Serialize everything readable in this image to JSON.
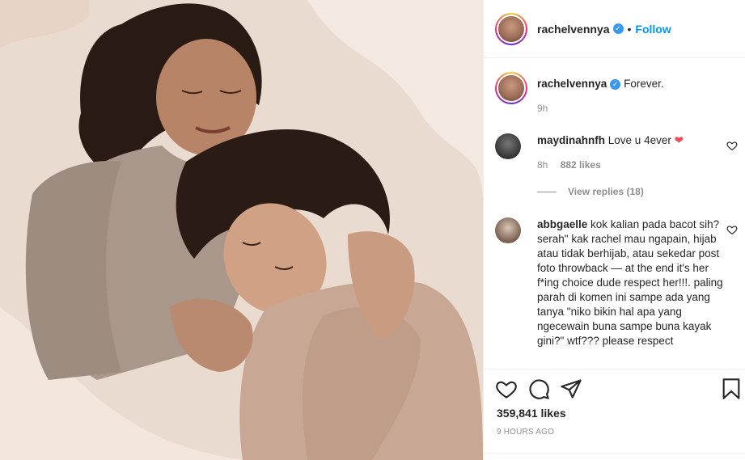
{
  "post": {
    "username": "rachelvennya",
    "follow_label": "Follow",
    "dot": "•",
    "verified_mark": "✓"
  },
  "caption": {
    "username": "rachelvennya",
    "text": "Forever.",
    "time": "9h"
  },
  "comments": [
    {
      "username": "maydinahnfh",
      "text": "Love u 4ever",
      "emoji": "❤",
      "time": "8h",
      "likes": "882 likes",
      "view_replies": "View replies (18)"
    },
    {
      "username": "abbgaelle",
      "text": "kok kalian pada bacot sih? serah\" kak rachel mau ngapain, hijab atau tidak berhijab, atau sekedar post foto throwback — at the end it's her f*ing choice dude respect her!!!. paling parah di komen ini sampe ada yang tanya \"niko bikin hal apa yang ngecewain buna sampe buna kayak gini?\" wtf??? please respect"
    }
  ],
  "footer": {
    "likes": "359,841 likes",
    "time": "9 HOURS AGO"
  },
  "icons": {
    "like": "heart-icon",
    "comment": "comment-icon",
    "share": "share-icon",
    "save": "bookmark-icon"
  },
  "colors": {
    "link": "#0095f6",
    "muted": "#8e8e8e",
    "heart": "#ed4956"
  }
}
